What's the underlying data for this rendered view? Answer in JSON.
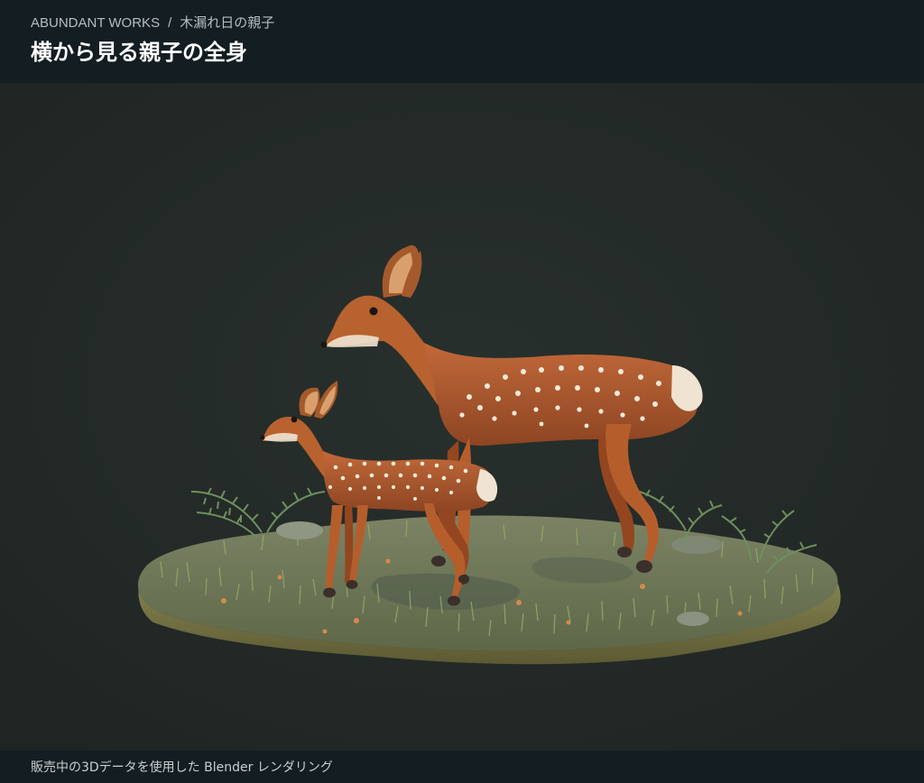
{
  "header": {
    "brand": "ABUNDANT WORKS",
    "separator": "/",
    "product": "木漏れ日の親子",
    "title": "横から見る親子の全身"
  },
  "footer": {
    "caption": "販売中の3Dデータを使用した Blender レンダリング"
  },
  "render": {
    "subject": "deer-doe-and-fawn",
    "background_color": "#232927",
    "base_color": "#6d7455",
    "deer_color": "#b45f2e",
    "spot_color": "#f1ead8"
  }
}
